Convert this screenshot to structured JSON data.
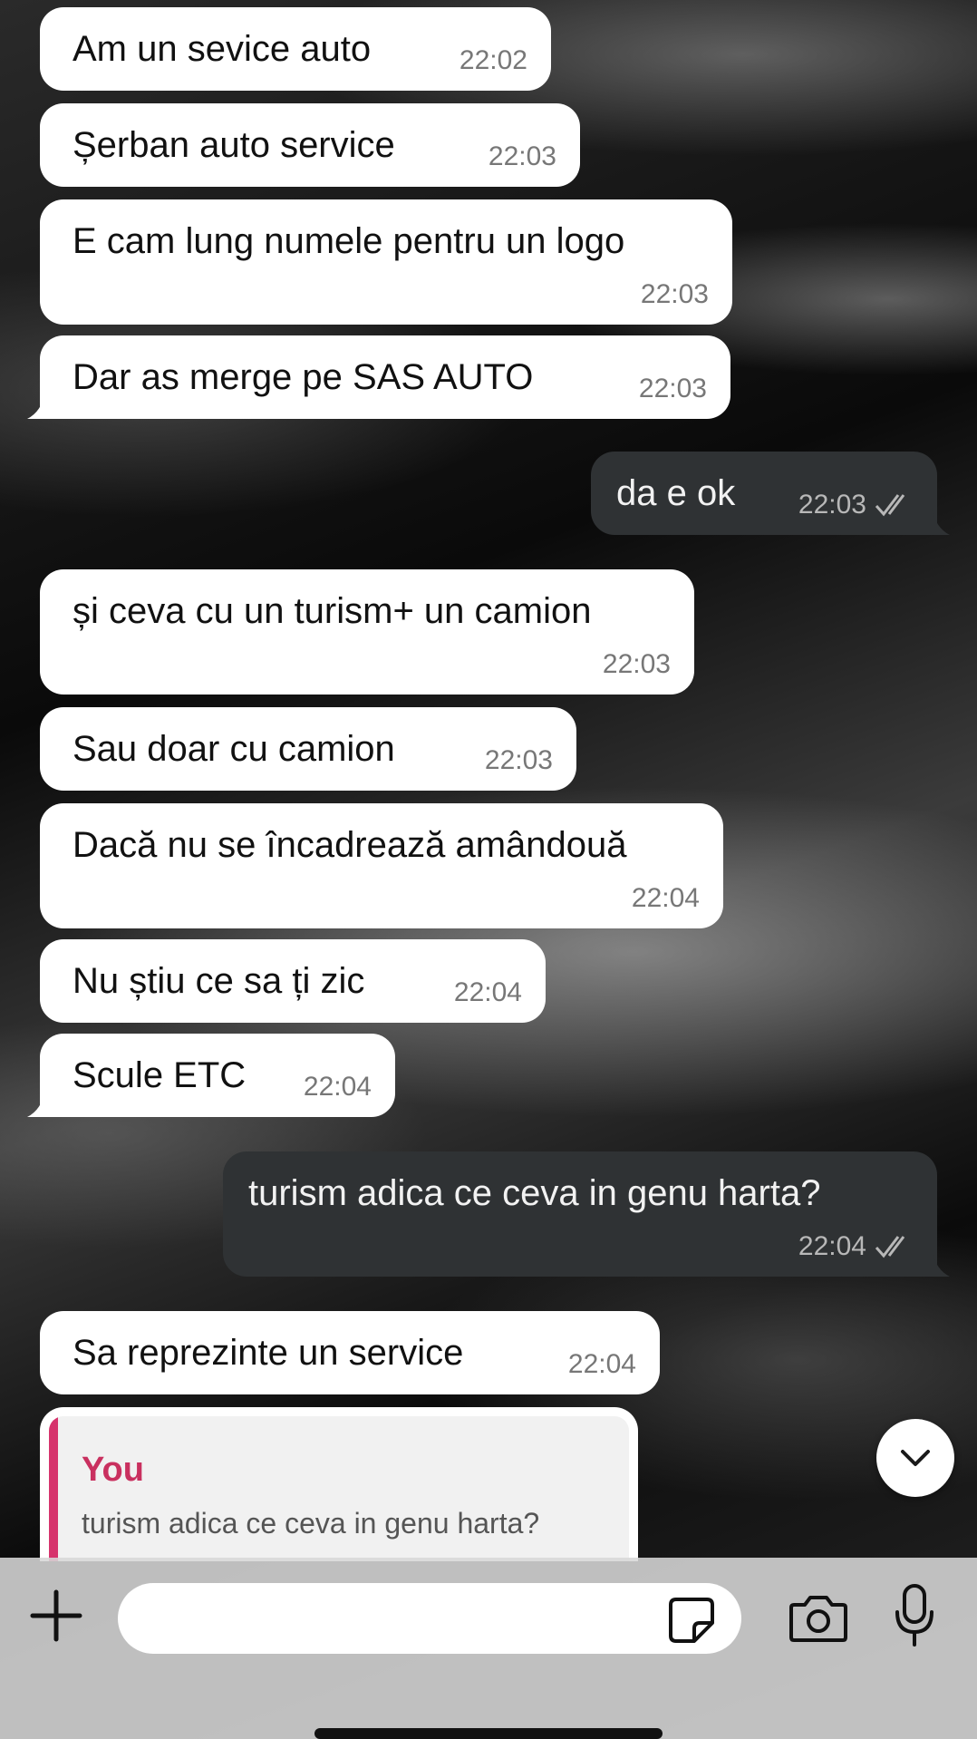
{
  "messages": [
    {
      "text": "Am un sevice auto",
      "time": "22:02"
    },
    {
      "text": "Șerban auto service",
      "time": "22:03"
    },
    {
      "text": "E cam lung numele pentru un logo",
      "time": "22:03"
    },
    {
      "text": "Dar as merge pe SAS AUTO",
      "time": "22:03"
    },
    {
      "text": "da e ok",
      "time": "22:03"
    },
    {
      "text": "și ceva cu un turism+ un camion",
      "time": "22:03"
    },
    {
      "text": "Sau doar cu camion",
      "time": "22:03"
    },
    {
      "text": "Dacă nu se încadrează amândouă",
      "time": "22:04"
    },
    {
      "text": "Nu știu ce sa ți zic",
      "time": "22:04"
    },
    {
      "text": "Scule ETC",
      "time": "22:04"
    },
    {
      "text": "turism adica ce ceva in genu harta?",
      "time": "22:04"
    },
    {
      "text": "Sa reprezinte un service",
      "time": "22:04"
    }
  ],
  "reply_preview": {
    "sender": "You",
    "quoted_text": "turism adica ce ceva in genu harta?"
  },
  "composer": {
    "placeholder": ""
  },
  "icons": {
    "attach": "plus-icon",
    "sticker": "sticker-icon",
    "camera": "camera-icon",
    "mic": "microphone-icon",
    "scroll": "chevron-down-icon",
    "read_receipt": "double-check-icon"
  },
  "colors": {
    "incoming_bubble": "#ffffff",
    "outgoing_bubble": "#2f3234",
    "reply_accent": "#d6336c"
  }
}
